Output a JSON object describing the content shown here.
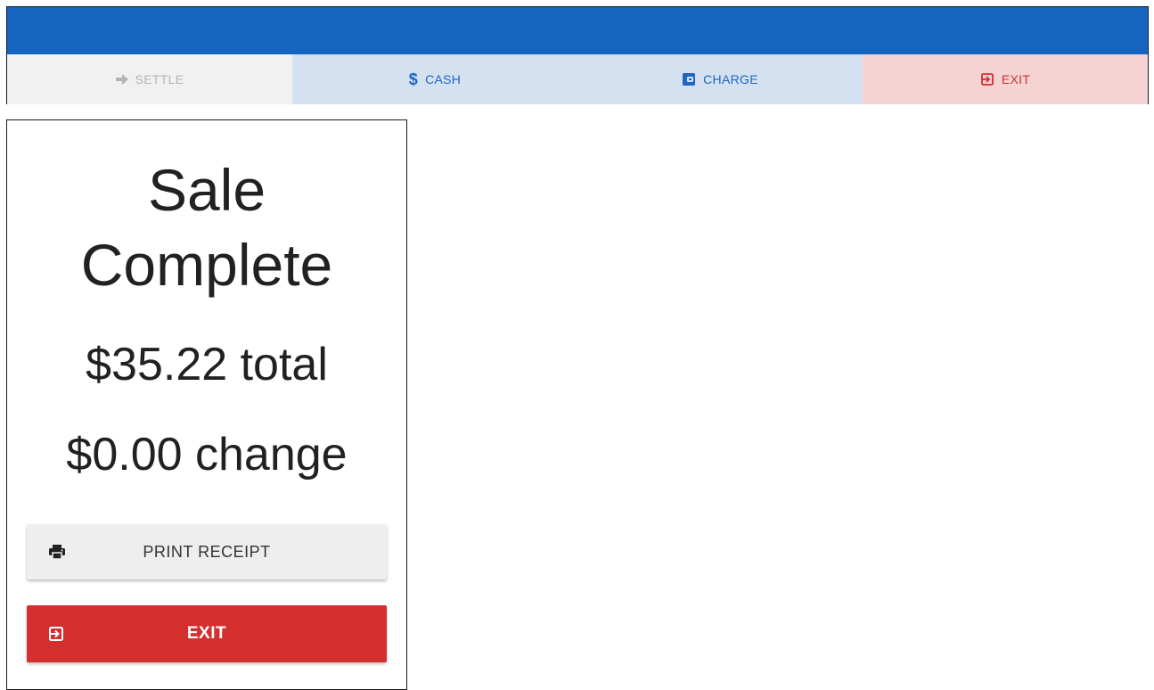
{
  "tabs": {
    "settle_label": "SETTLE",
    "cash_label": "CASH",
    "charge_label": "CHARGE",
    "exit_label": "EXIT"
  },
  "summary": {
    "title_line1": "Sale",
    "title_line2": "Complete",
    "total": "$35.22 total",
    "change": "$0.00 change"
  },
  "buttons": {
    "print_label": "PRINT RECEIPT",
    "exit_label": "EXIT"
  },
  "icons": {
    "settle": "arrow-right-icon",
    "cash": "dollar-icon",
    "charge": "credit-card-icon",
    "exit": "exit-icon",
    "print": "printer-icon"
  },
  "colors": {
    "header_blue": "#1565c0",
    "exit_red": "#d32f2f",
    "tab_blue_text": "#1e66c2",
    "tab_blue_bg": "#d4e1f1",
    "tab_red_bg": "#f6d3d3"
  }
}
